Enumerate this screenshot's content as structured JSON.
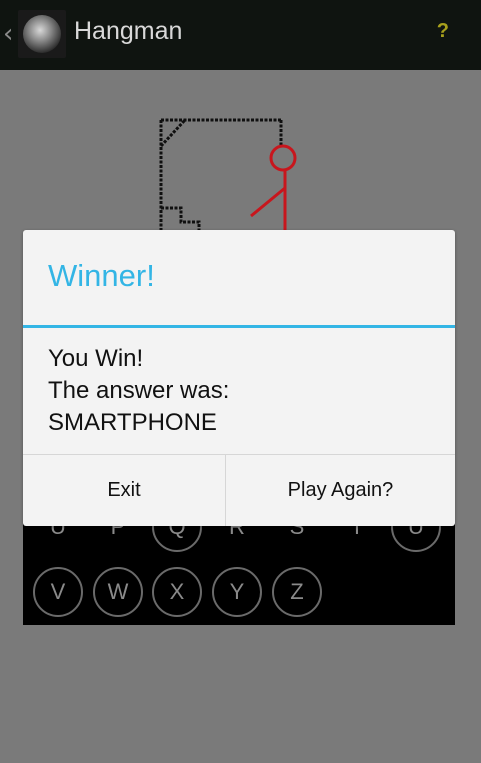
{
  "actionbar": {
    "title": "Hangman",
    "help_label": "?",
    "icons": {
      "up": "chevron-left-icon",
      "app": "hangman-ball-icon"
    }
  },
  "keyboard": {
    "row1_partial": [
      "U",
      "P",
      "Q",
      "R",
      "S",
      "T",
      "U"
    ],
    "row2": [
      "V",
      "W",
      "X",
      "Y",
      "Z"
    ]
  },
  "dialog": {
    "title": "Winner!",
    "line1": "You Win!",
    "line2": "The answer was:",
    "answer": "SMARTPHONE",
    "exit_label": "Exit",
    "play_again_label": "Play Again?"
  },
  "colors": {
    "accent": "#33b5e5",
    "actionbar": "#0f1410",
    "dim_overlay": "#7a7a7a",
    "hangman_red": "#c8161d",
    "help": "#a7a01c"
  }
}
